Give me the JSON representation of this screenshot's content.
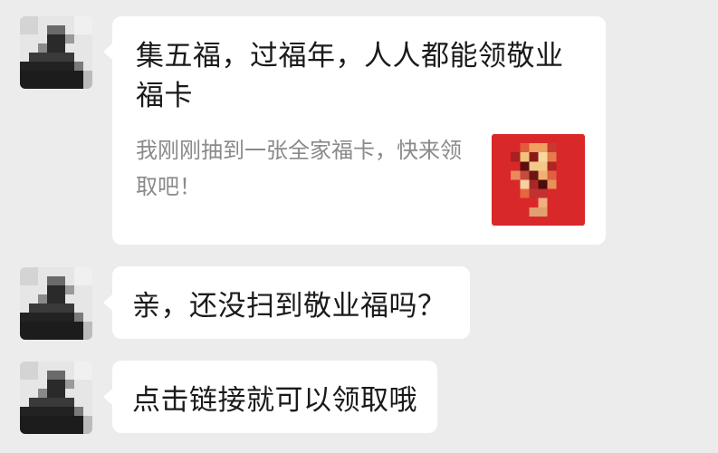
{
  "messages": [
    {
      "type": "link-card",
      "title": "集五福，过福年，人人都能领敬业福卡",
      "description": "我刚刚抽到一张全家福卡，快来领取吧！",
      "thumbnail_color": "#d8282a"
    },
    {
      "type": "text",
      "text": "亲，还没扫到敬业福吗？"
    },
    {
      "type": "text",
      "text": "点击链接就可以领取哦"
    }
  ],
  "avatar_icon": "pixelated-avatar-icon",
  "colors": {
    "background": "#ececec",
    "bubble": "#ffffff",
    "text": "#1a1a1a",
    "muted_text": "#8a8a8a"
  }
}
